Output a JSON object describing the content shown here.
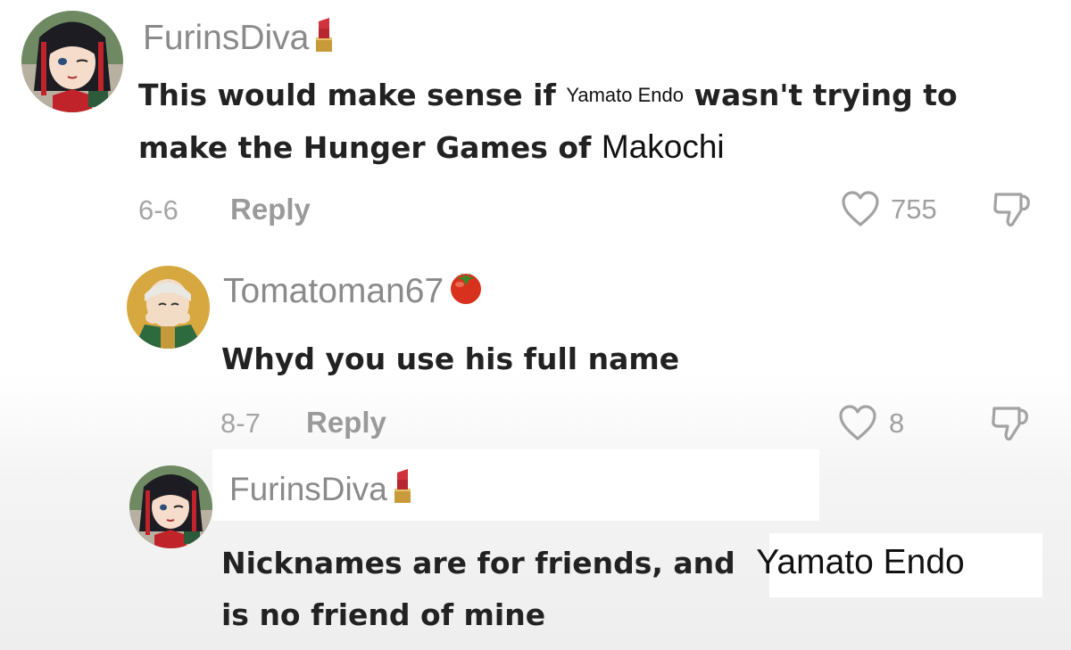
{
  "comments": [
    {
      "username": "FurinsDiva",
      "username_emoji": "lipstick",
      "text_before": "This would make sense if",
      "mention": "Yamato Endo",
      "text_after": "wasn't trying to",
      "line2": "make the Hunger Games of",
      "line2_mention": "Makochi",
      "date": "6-6",
      "reply_label": "Reply",
      "likes": "755"
    },
    {
      "username": "Tomatoman67",
      "username_emoji": "tomato",
      "text": "Whyd you use his full name",
      "date": "8-7",
      "reply_label": "Reply",
      "likes": "8"
    },
    {
      "username": "FurinsDiva",
      "username_emoji": "lipstick",
      "text_before": "Nicknames are for friends, and",
      "mention": "Yamato Endo",
      "line2": "is no friend of mine"
    }
  ],
  "colors": {
    "username": "#8a8a8a",
    "text": "#222222",
    "meta": "#a0a0a0"
  },
  "icons": {
    "like": "heart-outline-icon",
    "dislike": "thumbs-down-icon"
  }
}
